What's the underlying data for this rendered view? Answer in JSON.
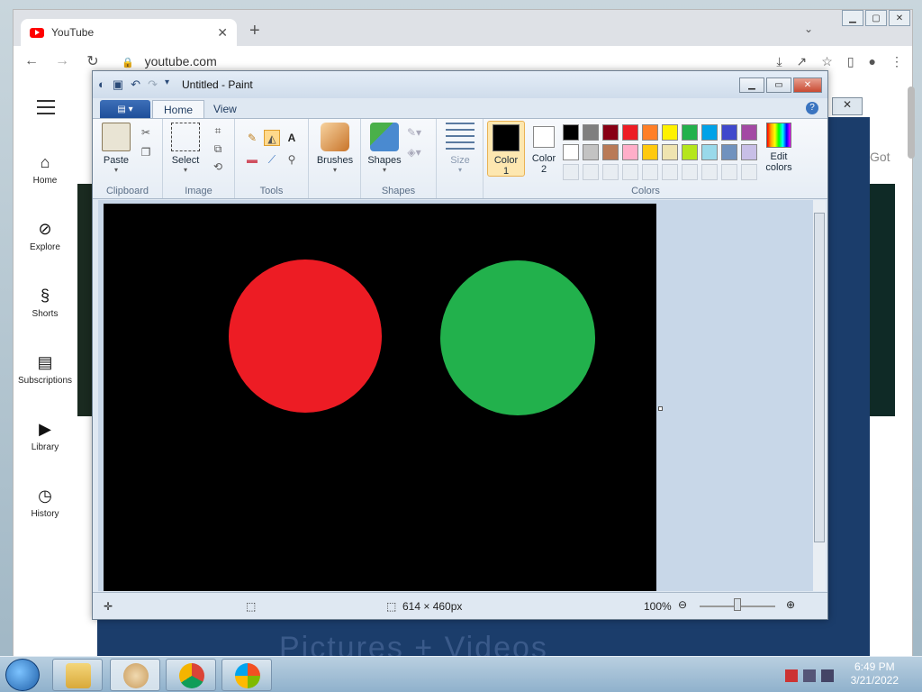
{
  "chrome": {
    "tab_title": "YouTube",
    "url": "youtube.com",
    "got": "Got"
  },
  "youtube": {
    "side_items": [
      {
        "label": "Home"
      },
      {
        "label": "Explore"
      },
      {
        "label": "Shorts"
      },
      {
        "label": "Subscriptions"
      },
      {
        "label": "Library"
      },
      {
        "label": "History"
      }
    ],
    "background_text": "Pictures + Videos"
  },
  "paint": {
    "title": "Untitled - Paint",
    "tabs": [
      "Home",
      "View"
    ],
    "groups": {
      "clipboard": "Clipboard",
      "image": "Image",
      "tools": "Tools",
      "shapes": "Shapes",
      "colors": "Colors"
    },
    "buttons": {
      "paste": "Paste",
      "select": "Select",
      "brushes": "Brushes",
      "shapes": "Shapes",
      "size": "Size",
      "color1": "Color 1",
      "color2": "Color 2",
      "edit_colors": "Edit colors"
    },
    "palette_row1": [
      "#000000",
      "#7f7f7f",
      "#880015",
      "#ed1c24",
      "#ff7f27",
      "#fff200",
      "#22b14c",
      "#00a2e8",
      "#3f48cc",
      "#a349a4"
    ],
    "palette_row2": [
      "#ffffff",
      "#c3c3c3",
      "#b97a57",
      "#ffaec9",
      "#ffc90e",
      "#efe4b0",
      "#b5e61d",
      "#99d9ea",
      "#7092be",
      "#c8bfe7"
    ],
    "color1": "#000000",
    "color2": "#ffffff",
    "canvas": {
      "background": "#000000",
      "circles": [
        {
          "color": "#ed1c24"
        },
        {
          "color": "#22b14c"
        }
      ]
    },
    "status": {
      "dimensions": "614 × 460px",
      "zoom": "100%"
    }
  },
  "taskbar": {
    "time": "6:49 PM",
    "date": "3/21/2022"
  }
}
